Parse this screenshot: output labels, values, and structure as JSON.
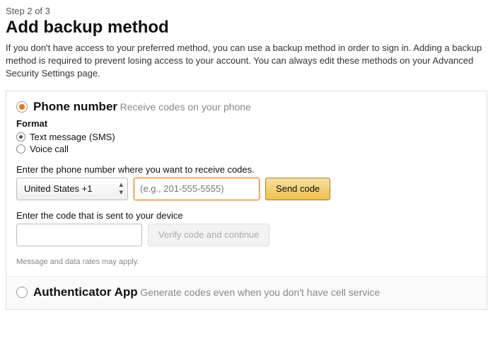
{
  "step_indicator": "Step 2 of 3",
  "title": "Add backup method",
  "intro": "If you don't have access to your preferred method, you can use a backup method in order to sign in. Adding a backup method is required to prevent losing access to your account. You can always edit these methods on your Advanced Security Settings page.",
  "phone_option": {
    "title": "Phone number",
    "subtitle": "Receive codes on your phone",
    "selected": true,
    "format_label": "Format",
    "format_sms": "Text message (SMS)",
    "format_voice": "Voice call",
    "enter_phone_label": "Enter the phone number where you want to receive codes.",
    "country_selected": "United States +1",
    "phone_placeholder": "(e.g., 201-555-5555)",
    "phone_value": "",
    "send_code_label": "Send code",
    "enter_code_label": "Enter the code that is sent to your device",
    "code_value": "",
    "verify_label": "Verify code and continue",
    "fineprint": "Message and data rates may apply."
  },
  "auth_app_option": {
    "title": "Authenticator App",
    "subtitle": "Generate codes even when you don't have cell service",
    "selected": false
  }
}
